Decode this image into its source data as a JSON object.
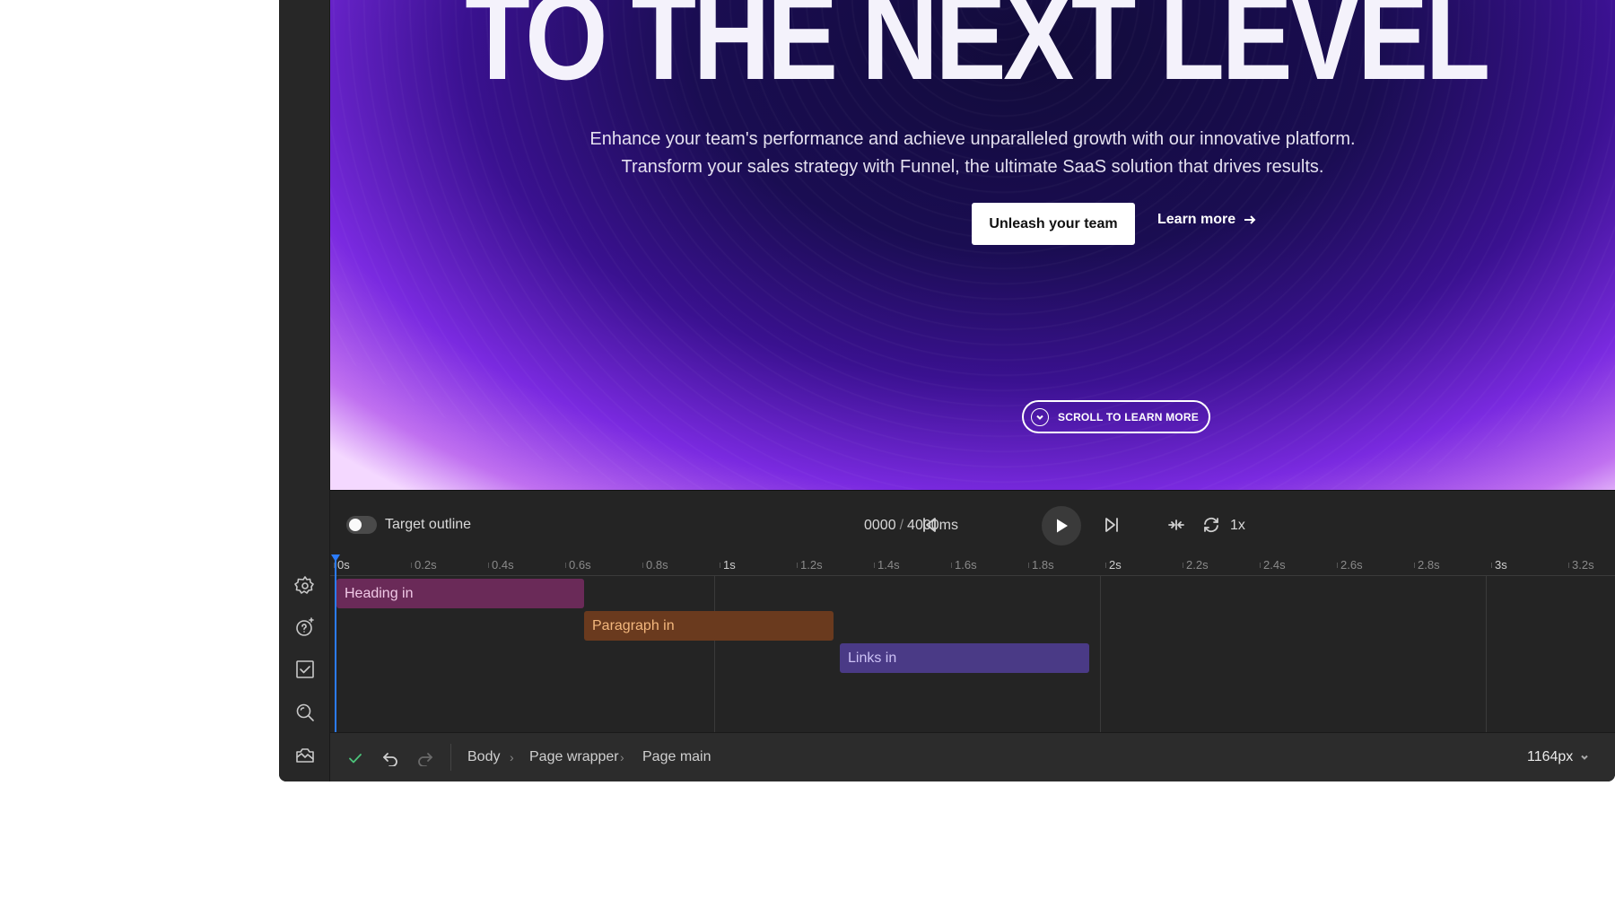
{
  "hero": {
    "headline": "TO THE NEXT LEVEL",
    "subcopy_line1": "Enhance your team's performance and achieve unparalleled growth with our innovative platform.",
    "subcopy_line2": "Transform your sales strategy with Funnel, the ultimate SaaS solution that drives results.",
    "cta_primary": "Unleash your team",
    "cta_secondary": "Learn more",
    "scroll_label": "SCROLL TO LEARN MORE"
  },
  "controls": {
    "toggle_label": "Target outline",
    "time_current": "0000",
    "time_total": "4000ms",
    "time_separator": "/",
    "speed": "1x"
  },
  "ruler": {
    "ticks": [
      "0s",
      "0.2s",
      "0.4s",
      "0.6s",
      "0.8s",
      "1s",
      "1.2s",
      "1.4s",
      "1.6s",
      "1.8s",
      "2s",
      "2.2s",
      "2.4s",
      "2.6s",
      "2.8s",
      "3s",
      "3.2s"
    ]
  },
  "timeline": {
    "clips": [
      {
        "label": "Heading in",
        "color": "#6a2a58"
      },
      {
        "label": "Paragraph in",
        "color": "#6a3a1e"
      },
      {
        "label": "Links in",
        "color": "#4a3a86"
      }
    ]
  },
  "statusbar": {
    "breadcrumbs": [
      "Body",
      "Page wrapper",
      "Page main"
    ],
    "breadcrumb_separator": "›",
    "width_value": "1164px"
  },
  "colors": {
    "accent": "#2b7cff",
    "check": "#4cc37a"
  },
  "icons": {
    "rail": [
      "gear-icon",
      "help-sparkle-icon",
      "checkbox-icon",
      "search-icon",
      "camera-icon"
    ]
  }
}
